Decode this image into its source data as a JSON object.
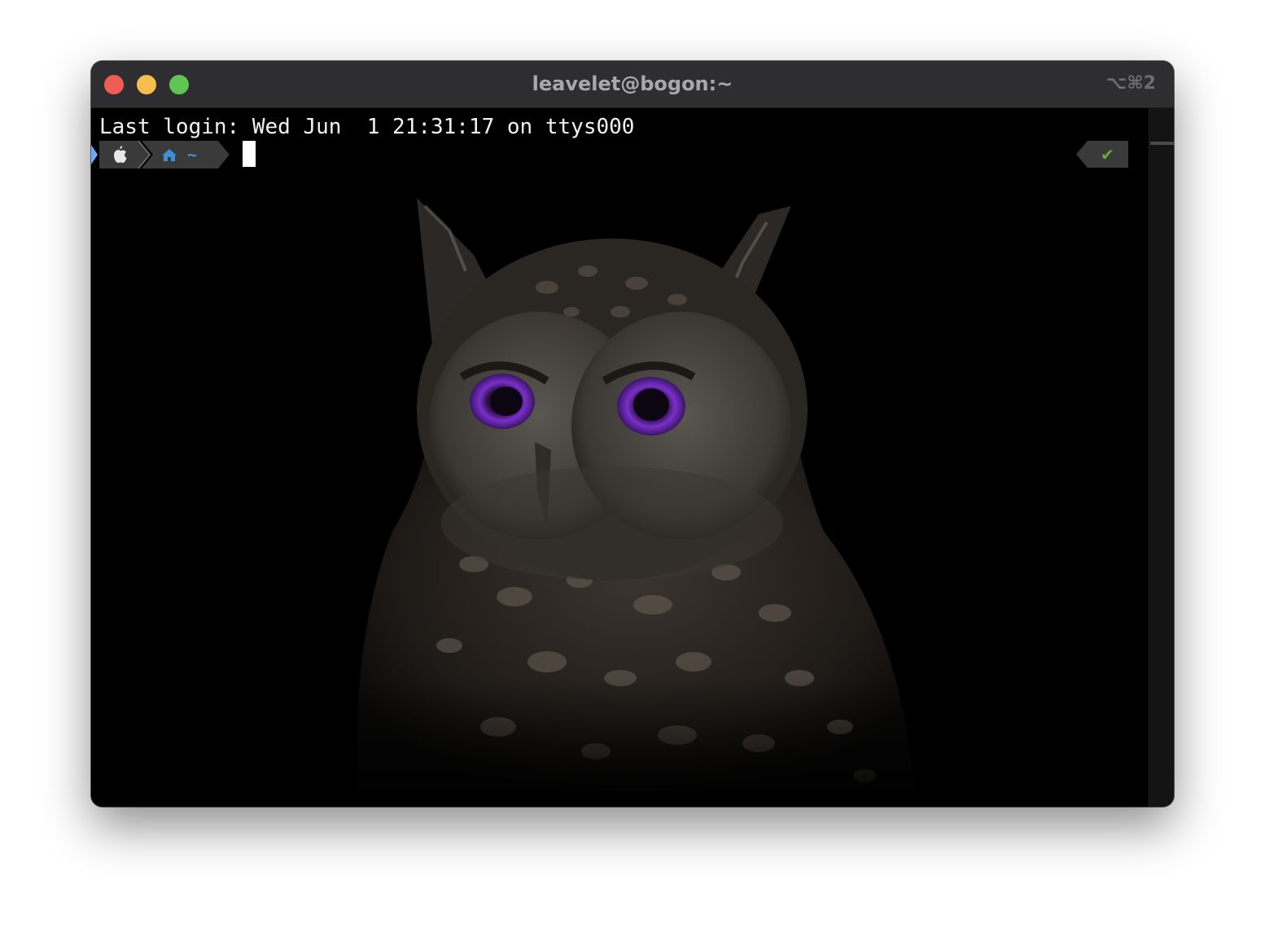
{
  "window": {
    "title": "leavelet@bogon:~",
    "shortcut": "⌥⌘2",
    "traffic_lights": {
      "close_color": "#ee5c54",
      "minimize_color": "#f5be4f",
      "zoom_color": "#5fc454"
    }
  },
  "terminal": {
    "last_login_line": "Last login: Wed Jun  1 21:31:17 on ttys000",
    "prompt": {
      "os_icon": "apple-icon",
      "home_icon": "home-icon",
      "directory": "~",
      "segment_color": "#3a3a3a",
      "dir_color": "#3d8fd6"
    },
    "status": {
      "icon": "checkmark-icon",
      "symbol": "✔",
      "color": "#5faf3a"
    }
  },
  "background": {
    "image": "owl-wallpaper",
    "eye_color": "#7a2fc9"
  }
}
